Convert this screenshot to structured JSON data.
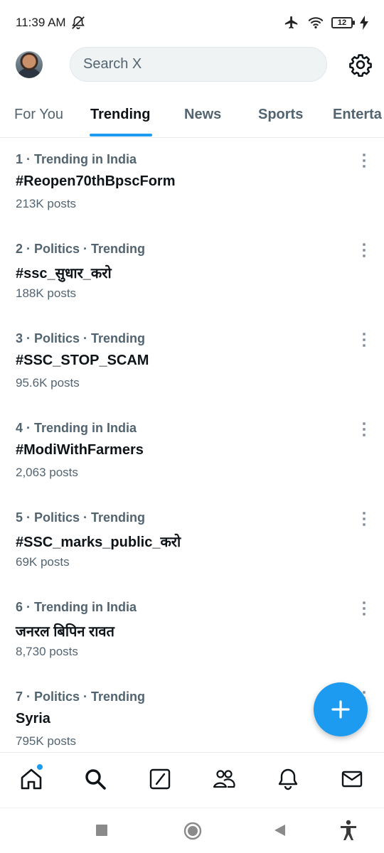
{
  "status": {
    "time": "11:39 AM",
    "battery": "12"
  },
  "header": {
    "search_placeholder": "Search X"
  },
  "tabs": [
    {
      "label": "For You"
    },
    {
      "label": "Trending"
    },
    {
      "label": "News"
    },
    {
      "label": "Sports"
    },
    {
      "label": "Enterta"
    }
  ],
  "trends": [
    {
      "meta": "1 · Trending in India",
      "name": "#Reopen70thBpscForm",
      "count": "213K posts"
    },
    {
      "meta": "2 · Politics · Trending",
      "name": "#ssc_सुधार_करो",
      "count": "188K posts"
    },
    {
      "meta": "3 · Politics · Trending",
      "name": "#SSC_STOP_SCAM",
      "count": "95.6K posts"
    },
    {
      "meta": "4 · Trending in India",
      "name": "#ModiWithFarmers",
      "count": "2,063 posts"
    },
    {
      "meta": "5 · Politics · Trending",
      "name": "#SSC_marks_public_करो",
      "count": "69K posts"
    },
    {
      "meta": "6 · Trending in India",
      "name": "जनरल बिपिन रावत",
      "count": "8,730 posts"
    },
    {
      "meta": "7 · Politics · Trending",
      "name": "Syria",
      "count": "795K posts"
    }
  ],
  "icons": {
    "status": [
      "dnd-bell-off-icon",
      "airplane-icon",
      "wifi-icon",
      "battery-icon",
      "charging-bolt-icon"
    ],
    "header": [
      "avatar",
      "settings-gear-icon"
    ],
    "bottom_nav": [
      "home-icon",
      "search-icon",
      "compose-icon",
      "communities-icon",
      "notifications-icon",
      "messages-icon"
    ],
    "system_nav": [
      "recents-square-icon",
      "home-circle-icon",
      "back-triangle-icon",
      "accessibility-icon"
    ]
  },
  "colors": {
    "accent": "#1d9bf0",
    "text_primary": "#0f1419",
    "text_secondary": "#536471"
  }
}
